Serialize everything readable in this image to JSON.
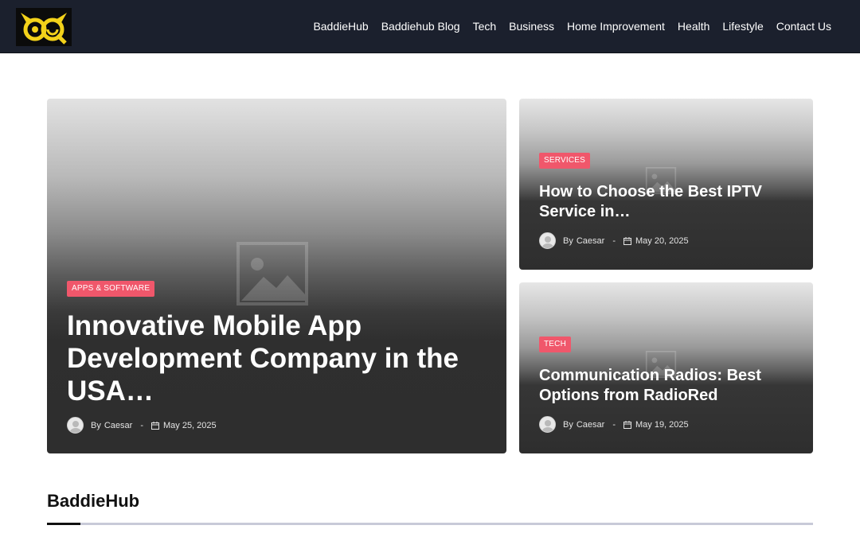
{
  "header": {
    "nav": [
      {
        "label": "BaddieHub"
      },
      {
        "label": "Baddiehub Blog"
      },
      {
        "label": "Tech"
      },
      {
        "label": "Business"
      },
      {
        "label": "Home Improvement"
      },
      {
        "label": "Health"
      },
      {
        "label": "Lifestyle"
      },
      {
        "label": "Contact Us"
      }
    ],
    "logo_icon": "owl-logo-icon",
    "logo_color": "#f3d21a"
  },
  "featured": {
    "main": {
      "category": "APPS & SOFTWARE",
      "title": "Innovative Mobile App Development Company in the USA…",
      "by": "By",
      "author": "Caesar",
      "separator": "-",
      "date": "May 25, 2025"
    },
    "side": [
      {
        "category": "SERVICES",
        "title": "How to Choose the Best IPTV Service in…",
        "by": "By",
        "author": "Caesar",
        "separator": "-",
        "date": "May 20, 2025"
      },
      {
        "category": "TECH",
        "title": "Communication Radios: Best Options from RadioRed",
        "by": "By",
        "author": "Caesar",
        "separator": "-",
        "date": "May 19, 2025"
      }
    ]
  },
  "section": {
    "title": "BaddieHub"
  },
  "colors": {
    "header_bg": "#1b202d",
    "badge": "#f0576b",
    "accent_line": "#111111"
  }
}
